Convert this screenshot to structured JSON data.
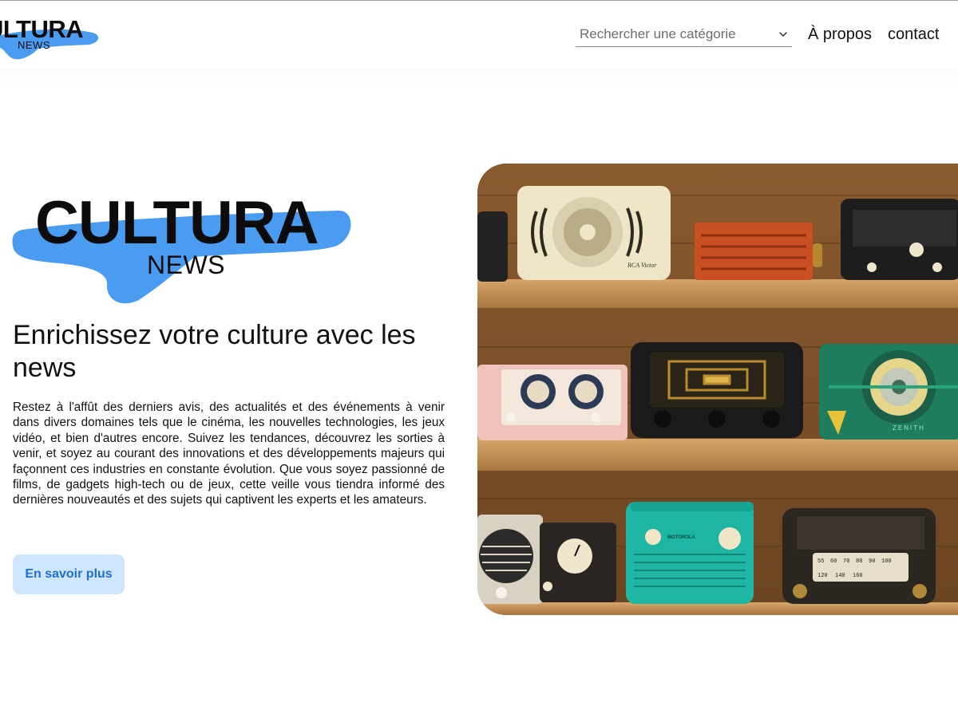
{
  "header": {
    "logo": {
      "word": "ULTURA",
      "sub": "NEWS"
    },
    "search": {
      "placeholder": "Rechercher une catégorie"
    },
    "nav": {
      "about": "À propos",
      "contact": "contact"
    }
  },
  "hero": {
    "logo": {
      "word": "CULTURA",
      "sub": "NEWS"
    },
    "title": "Enrichissez votre culture avec les news",
    "text": "Restez à l'affût des derniers avis, des actualités et des événements à venir dans divers domaines tels que le cinéma, les nouvelles technologies, les jeux vidéo, et bien d'autres encore. Suivez les tendances, découvrez les sorties à venir, et soyez au courant des innovations et des développements majeurs qui façonnent ces industries en constante évolution. Que vous soyez passionné de films, de gadgets high-tech ou de jeux, cette veille vous tiendra informé des dernières nouveautés et des sujets qui captivent les experts et les amateurs.",
    "cta": "En savoir plus",
    "image": {
      "radio_labels": [
        "RCA Victor",
        "MOTOROLA",
        "ZENITH"
      ],
      "dial_numbers": [
        "55",
        "60",
        "70",
        "80",
        "90",
        "100",
        "120",
        "140",
        "160"
      ]
    }
  },
  "colors": {
    "brand_blue": "#4a9cf0",
    "cta_bg": "#cfe6ff",
    "cta_text": "#1f6fd1"
  },
  "icons": {
    "chevron": "chevron-down-icon"
  }
}
